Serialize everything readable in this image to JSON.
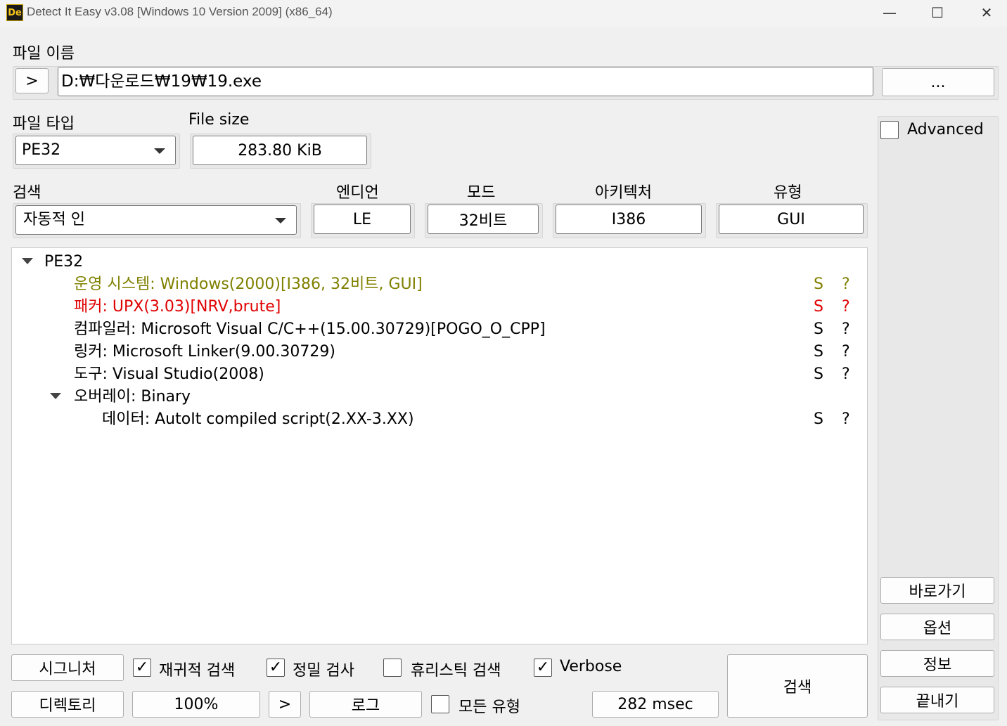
{
  "window": {
    "title": "Detect It Easy v3.08 [Windows 10 Version 2009] (x86_64)",
    "icon_text": "De",
    "minimize": "—",
    "maximize": "☐",
    "close": "✕"
  },
  "file": {
    "label": "파일 이름",
    "open_arrow": ">",
    "path": "D:₩다운로드₩19₩19.exe",
    "browse": "..."
  },
  "filetype": {
    "label": "파일 타입",
    "value": "PE32"
  },
  "filesize": {
    "label": "File size",
    "value": "283.80 KiB"
  },
  "advanced": {
    "label": "Advanced",
    "checked": false
  },
  "scan_mode": {
    "label": "검색",
    "value": "자동적 인"
  },
  "info": {
    "endian": {
      "label": "엔디언",
      "value": "LE"
    },
    "mode": {
      "label": "모드",
      "value": "32비트"
    },
    "arch": {
      "label": "아키텍처",
      "value": "I386"
    },
    "type": {
      "label": "유형",
      "value": "GUI"
    }
  },
  "results": {
    "root": "PE32",
    "items": [
      {
        "text": "운영 시스템: Windows(2000)[I386, 32비트, GUI]",
        "s": "S",
        "q": "?",
        "color": "#808000"
      },
      {
        "text": "패커: UPX(3.03)[NRV,brute]",
        "s": "S",
        "q": "?",
        "color": "#e00000"
      },
      {
        "text": "컴파일러: Microsoft Visual C/C++(15.00.30729)[POGO_O_CPP]",
        "s": "S",
        "q": "?",
        "color": "#000000"
      },
      {
        "text": "링커: Microsoft Linker(9.00.30729)",
        "s": "S",
        "q": "?",
        "color": "#000000"
      },
      {
        "text": "도구: Visual Studio(2008)",
        "s": "S",
        "q": "?",
        "color": "#000000"
      }
    ],
    "overlay": "오버레이: Binary",
    "overlay_child": {
      "text": "데이터: AutoIt compiled script(2.XX-3.XX)",
      "s": "S",
      "q": "?"
    }
  },
  "side_buttons": {
    "shortcuts": "바로가기",
    "options": "옵션",
    "about": "정보",
    "exit": "끝내기"
  },
  "bottom": {
    "signatures": "시그니처",
    "recursive": {
      "label": "재귀적 검색",
      "checked": true
    },
    "deep": {
      "label": "정밀 검사",
      "checked": true
    },
    "heuristic": {
      "label": "휴리스틱 검색",
      "checked": false
    },
    "verbose": {
      "label": "Verbose",
      "checked": true
    },
    "directory": "디렉토리",
    "progress": "100%",
    "next_arrow": ">",
    "log": "로그",
    "all_types": {
      "label": "모든 유형",
      "checked": false
    },
    "time": "282 msec",
    "scan": "검색"
  }
}
